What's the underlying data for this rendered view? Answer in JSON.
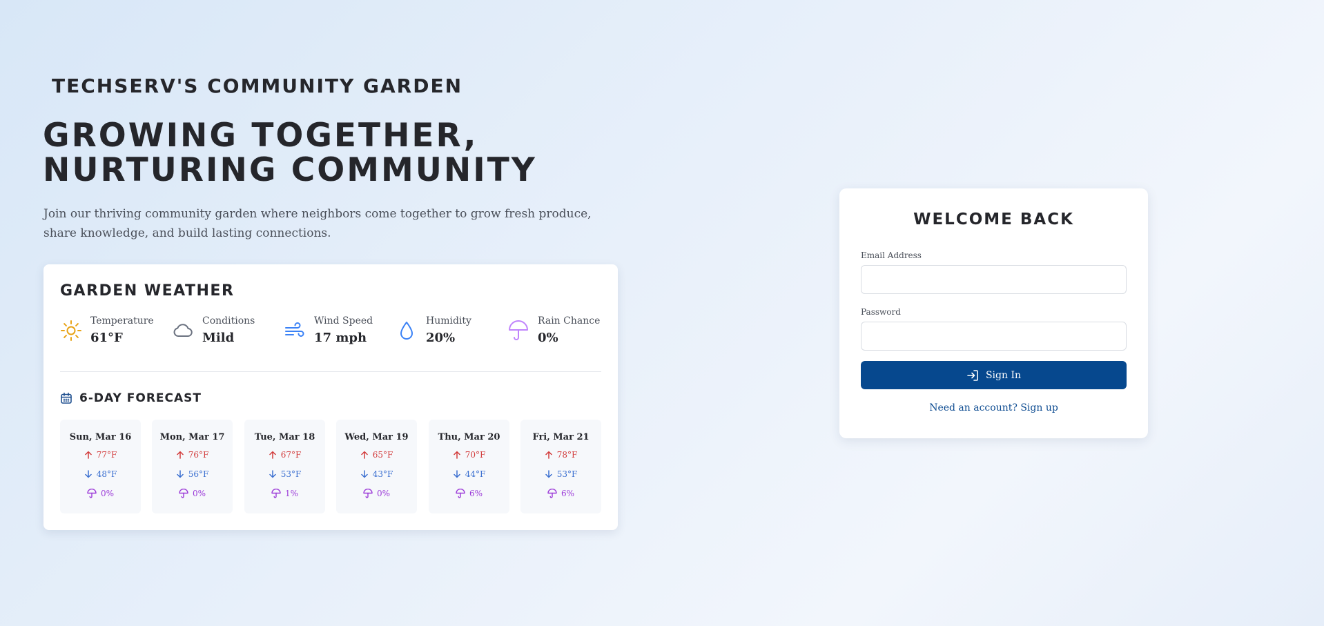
{
  "brand": "TECHSERV'S COMMUNITY GARDEN",
  "hero": {
    "title_line1": "GROWING TOGETHER,",
    "title_line2": "NURTURING COMMUNITY",
    "description": "Join our thriving community garden where neighbors come together to grow fresh produce, share knowledge, and build lasting connections."
  },
  "weather": {
    "title": "GARDEN WEATHER",
    "metrics": [
      {
        "label": "Temperature",
        "value": "61°F",
        "icon": "sun-icon",
        "color": "#e8a317"
      },
      {
        "label": "Conditions",
        "value": "Mild",
        "icon": "cloud-icon",
        "color": "#6b7280"
      },
      {
        "label": "Wind Speed",
        "value": "17 mph",
        "icon": "wind-icon",
        "color": "#3b82f6"
      },
      {
        "label": "Humidity",
        "value": "20%",
        "icon": "droplet-icon",
        "color": "#3b82f6"
      },
      {
        "label": "Rain Chance",
        "value": "0%",
        "icon": "umbrella-icon",
        "color": "#c084fc"
      }
    ],
    "forecast_title": "6-DAY FORECAST",
    "forecast": [
      {
        "day": "Sun, Mar 16",
        "high": "77°F",
        "low": "48°F",
        "rain": "0%"
      },
      {
        "day": "Mon, Mar 17",
        "high": "76°F",
        "low": "56°F",
        "rain": "0%"
      },
      {
        "day": "Tue, Mar 18",
        "high": "67°F",
        "low": "53°F",
        "rain": "1%"
      },
      {
        "day": "Wed, Mar 19",
        "high": "65°F",
        "low": "43°F",
        "rain": "0%"
      },
      {
        "day": "Thu, Mar 20",
        "high": "70°F",
        "low": "44°F",
        "rain": "6%"
      },
      {
        "day": "Fri, Mar 21",
        "high": "78°F",
        "low": "53°F",
        "rain": "6%"
      }
    ]
  },
  "login": {
    "title": "WELCOME BACK",
    "email_label": "Email Address",
    "email_value": "",
    "password_label": "Password",
    "password_value": "",
    "signin_label": "Sign In",
    "signup_link": "Need an account? Sign up",
    "button_color": "#06488e"
  }
}
